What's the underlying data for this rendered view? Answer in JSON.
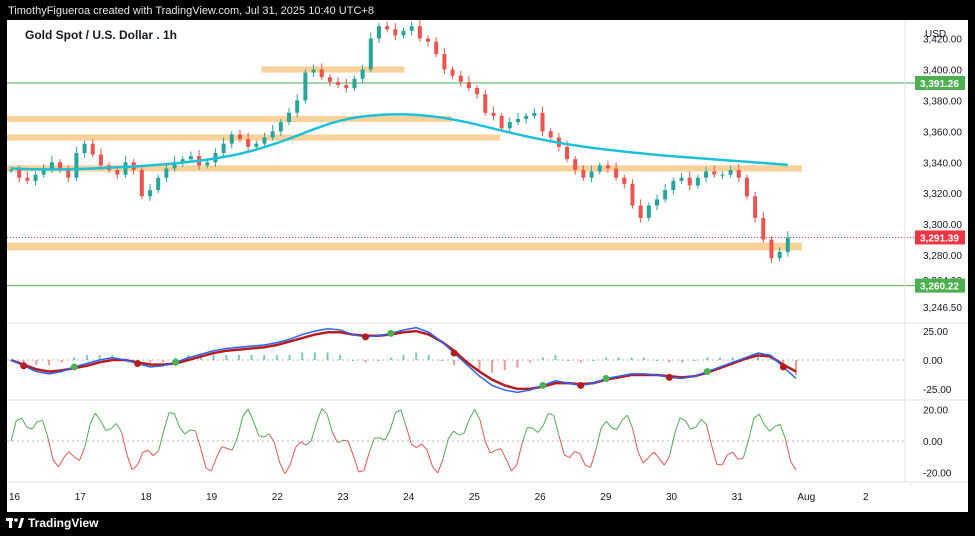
{
  "header": {
    "attribution": "TimothyFigueroa created with TradingView.com, Jul 31, 2025 10:40 UTC+8"
  },
  "footer": {
    "brand": "TradingView"
  },
  "chart": {
    "title": "Gold Spot / U.S. Dollar . 1h",
    "currency": "USD"
  },
  "colors": {
    "bullish": "#26a69a",
    "bearish": "#ef5350",
    "zone": "#f8c98a",
    "ma": "#1ec0d8",
    "hline": "#4caf50",
    "price_tag": "#f23645",
    "level_tag": "#4caf50",
    "macd": "#2962ff",
    "signal": "#b71c1c",
    "cross_green": "#4caf50",
    "cross_red": "#b71c1c",
    "osc_up": "#4caf50",
    "osc_down": "#ef5350"
  },
  "chart_data": [
    {
      "type": "candlestick",
      "title": "Gold Spot / U.S. Dollar . 1h",
      "ylim": [
        3238,
        3432
      ],
      "y_ticks": [
        "3,420.00",
        "3,400.00",
        "3,380.00",
        "3,360.00",
        "3,340.00",
        "3,320.00",
        "3,300.00",
        "3,280.00",
        "3,264.00",
        "3,246.50"
      ],
      "y_tick_values": [
        3420,
        3400,
        3380,
        3360,
        3340,
        3320,
        3300,
        3280,
        3264,
        3246.5
      ],
      "x_labels": [
        "16",
        "17",
        "18",
        "19",
        "22",
        "23",
        "24",
        "25",
        "26",
        "29",
        "30",
        "31",
        "Aug",
        "2"
      ],
      "current_price": "3,291.39",
      "current_price_value": 3291.39,
      "horizontal_lines": [
        {
          "label": "3,391.26",
          "value": 3391.26
        },
        {
          "label": "3,260.22",
          "value": 3260.22
        }
      ],
      "zones": [
        {
          "from": 3398,
          "to": 3402,
          "start": 0.32,
          "end": 0.5
        },
        {
          "from": 3366,
          "to": 3370,
          "start": 0.0,
          "end": 0.56
        },
        {
          "from": 3354,
          "to": 3358,
          "start": 0.0,
          "end": 0.62
        },
        {
          "from": 3334,
          "to": 3338,
          "start": 0.0,
          "end": 1.0
        },
        {
          "from": 3283,
          "to": 3288,
          "start": 0.0,
          "end": 1.0
        }
      ],
      "closes": [
        3335,
        3330,
        3328,
        3332,
        3336,
        3340,
        3335,
        3330,
        3346,
        3352,
        3345,
        3338,
        3335,
        3332,
        3340,
        3335,
        3318,
        3322,
        3330,
        3336,
        3340,
        3342,
        3344,
        3338,
        3340,
        3346,
        3352,
        3358,
        3355,
        3350,
        3352,
        3356,
        3360,
        3366,
        3372,
        3380,
        3398,
        3400,
        3395,
        3392,
        3390,
        3388,
        3394,
        3400,
        3420,
        3428,
        3426,
        3422,
        3425,
        3428,
        3420,
        3418,
        3410,
        3400,
        3396,
        3392,
        3388,
        3384,
        3372,
        3370,
        3362,
        3366,
        3368,
        3370,
        3372,
        3360,
        3356,
        3350,
        3342,
        3335,
        3330,
        3334,
        3338,
        3336,
        3330,
        3326,
        3312,
        3304,
        3312,
        3316,
        3322,
        3328,
        3330,
        3325,
        3330,
        3334,
        3332,
        3332,
        3335,
        3330,
        3318,
        3304,
        3290,
        3278,
        3282,
        3291.39
      ],
      "ma_values": [
        3336,
        3335.8,
        3335.6,
        3335.5,
        3335.4,
        3335.4,
        3335.4,
        3335.5,
        3335.6,
        3335.8,
        3336,
        3336.2,
        3336.5,
        3336.8,
        3337,
        3337.3,
        3337.6,
        3338,
        3338.4,
        3338.8,
        3339.3,
        3339.8,
        3340.4,
        3341,
        3341.7,
        3342.5,
        3343.4,
        3344.4,
        3345.5,
        3346.8,
        3348.2,
        3349.8,
        3351.5,
        3353.3,
        3355.2,
        3357.2,
        3359.3,
        3361.3,
        3363.2,
        3365,
        3366.5,
        3367.8,
        3368.8,
        3369.6,
        3370.2,
        3370.6,
        3370.9,
        3371,
        3371,
        3370.8,
        3370.5,
        3370,
        3369.4,
        3368.6,
        3367.7,
        3366.7,
        3365.6,
        3364.4,
        3363.1,
        3361.8,
        3360.5,
        3359.2,
        3358,
        3356.8,
        3355.7,
        3354.6,
        3353.6,
        3352.6,
        3351.7,
        3350.9,
        3350.1,
        3349.4,
        3348.7,
        3348.1,
        3347.5,
        3346.9,
        3346.3,
        3345.8,
        3345.3,
        3344.8,
        3344.3,
        3343.9,
        3343.5,
        3343.1,
        3342.7,
        3342.3,
        3341.9,
        3341.5,
        3341.1,
        3340.7,
        3340.3,
        3339.9,
        3339.5,
        3339.1,
        3338.7,
        3338.3
      ]
    },
    {
      "type": "line",
      "title": "MACD",
      "ylim": [
        -32,
        32
      ],
      "y_ticks": [
        "25.00",
        "0.00",
        "-25.00"
      ],
      "y_tick_values": [
        25,
        0,
        -25
      ],
      "series": [
        {
          "values": [
            0,
            -5,
            -10,
            -12,
            -10,
            -6,
            -3,
            0,
            2,
            0,
            -3,
            -6,
            -5,
            -2,
            2,
            5,
            8,
            10,
            11,
            12,
            13,
            15,
            18,
            22,
            25,
            27,
            26,
            22,
            20,
            21,
            23,
            26,
            28,
            24,
            16,
            6,
            -4,
            -14,
            -22,
            -26,
            -28,
            -26,
            -22,
            -18,
            -20,
            -22,
            -20,
            -16,
            -14,
            -12,
            -12,
            -13,
            -15,
            -16,
            -14,
            -10,
            -6,
            -2,
            2,
            6,
            4,
            -6,
            -16
          ]
        },
        {
          "values": [
            0,
            -4,
            -8,
            -10,
            -9,
            -7,
            -5,
            -2,
            0,
            0,
            -2,
            -4,
            -4,
            -3,
            0,
            3,
            6,
            8,
            9,
            10,
            11,
            13,
            16,
            19,
            22,
            24,
            24,
            22,
            21,
            21,
            22,
            24,
            25,
            22,
            16,
            8,
            -2,
            -10,
            -17,
            -22,
            -25,
            -25,
            -23,
            -20,
            -20,
            -21,
            -20,
            -17,
            -15,
            -13,
            -13,
            -13,
            -14,
            -15,
            -14,
            -11,
            -7,
            -3,
            1,
            4,
            3,
            -4,
            -10
          ]
        }
      ]
    },
    {
      "type": "line",
      "title": "Oscillator",
      "ylim": [
        -26,
        26
      ],
      "y_ticks": [
        "20.00",
        "0.00",
        "-20.00"
      ],
      "y_tick_values": [
        20,
        0,
        -20
      ]
    }
  ]
}
